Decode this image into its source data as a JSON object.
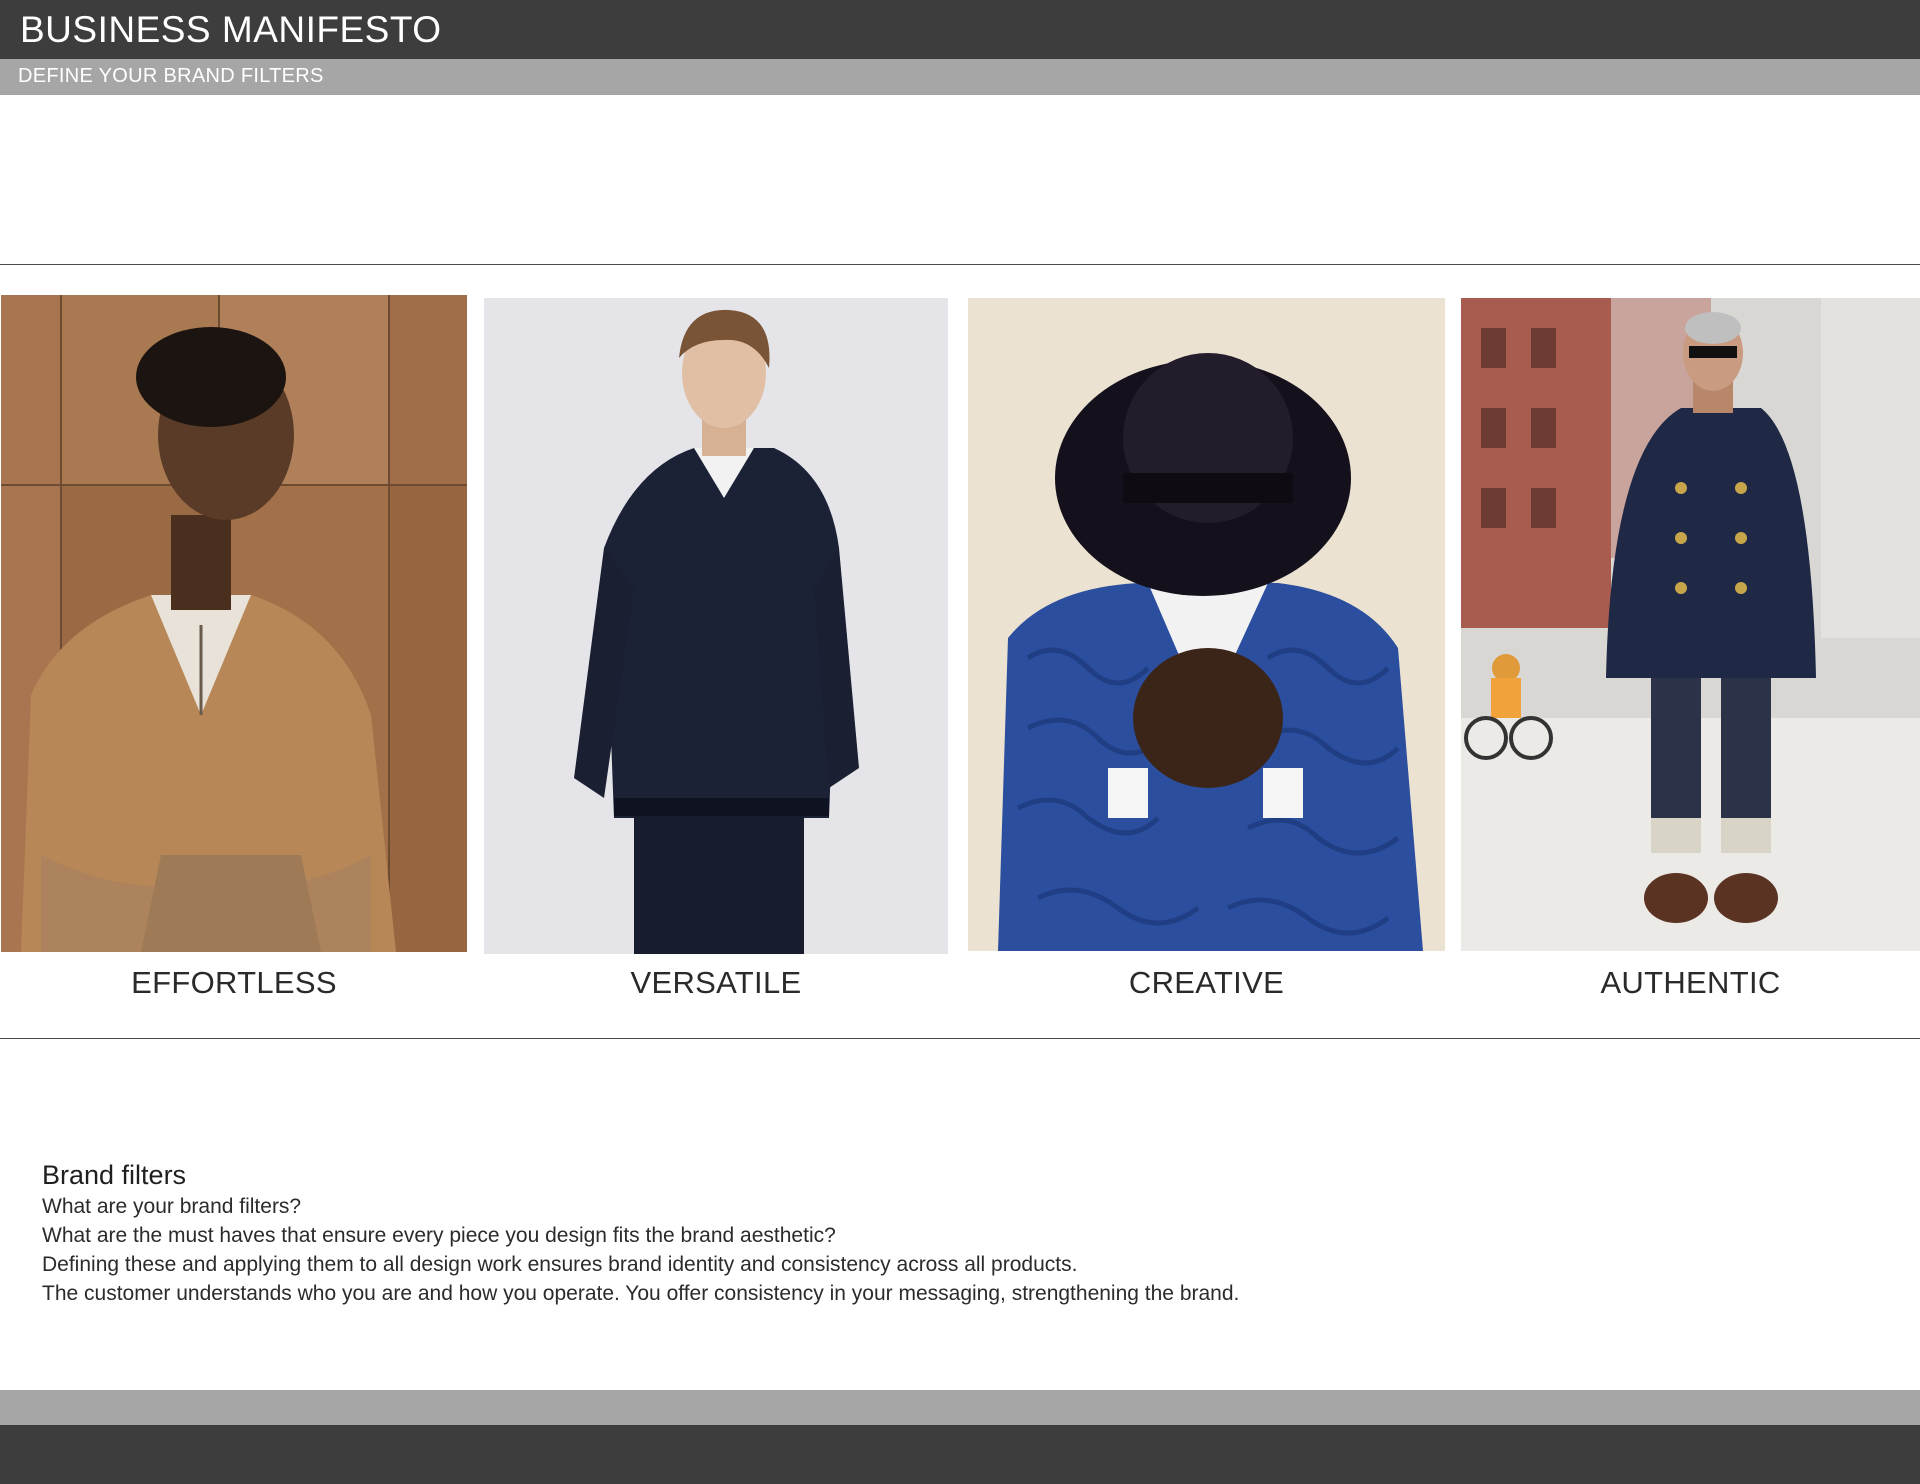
{
  "header": {
    "title": "BUSINESS MANIFESTO",
    "subtitle": "DEFINE YOUR BRAND FILTERS"
  },
  "filters": [
    {
      "label": "EFFORTLESS",
      "colors": {
        "bg": "#9a6a44",
        "accent": "#b07d52",
        "garment": "#b88757",
        "skin": "#5a3b27"
      }
    },
    {
      "label": "VERSATILE",
      "colors": {
        "bg": "#ececee",
        "accent": "#dcdde0",
        "garment": "#1c2236",
        "skin": "#e1bfa4"
      }
    },
    {
      "label": "CREATIVE",
      "colors": {
        "bg": "#efe5d7",
        "accent": "#e6d9c7",
        "garment": "#2b4f9e",
        "skin": "#3b2518"
      }
    },
    {
      "label": "AUTHENTIC",
      "colors": {
        "bg": "#d9d7d4",
        "accent": "#a85b4f",
        "garment": "#1f2844",
        "skin": "#c99b80"
      }
    }
  ],
  "copy": {
    "heading": "Brand filters",
    "lines": [
      "What are your brand filters?",
      "What are the must haves that ensure every piece you design fits the brand aesthetic?",
      "Defining these and applying them to all design work ensures brand identity and consistency across all products.",
      "The customer understands who you are and how you operate. You offer consistency in your messaging, strengthening the brand."
    ]
  }
}
